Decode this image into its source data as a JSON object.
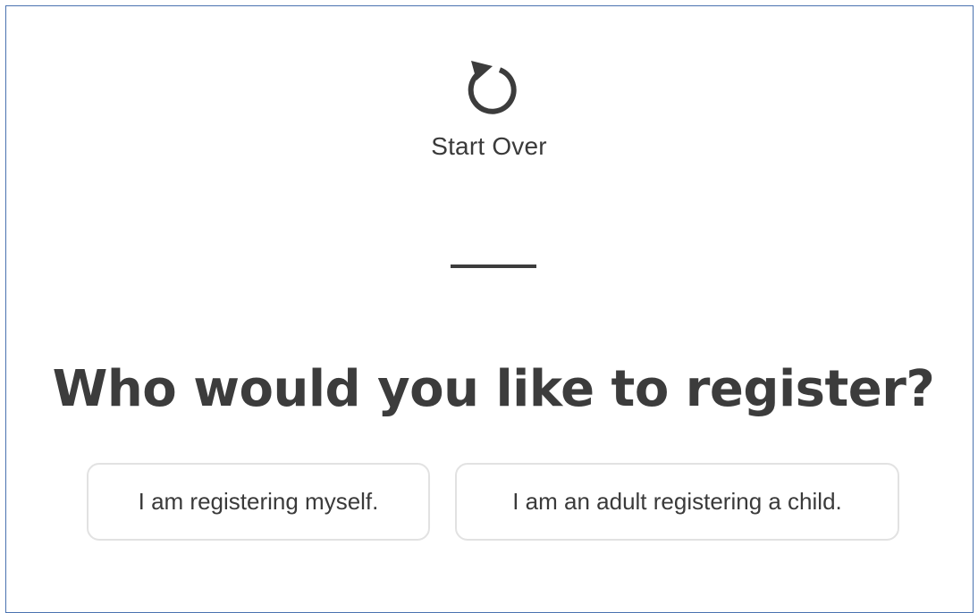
{
  "start_over": {
    "label": "Start Over",
    "icon": "refresh-icon"
  },
  "headline": "Who would you like to register?",
  "choices": {
    "self_label": "I am registering myself.",
    "child_label": "I am an adult registering a child."
  },
  "colors": {
    "text": "#3c3c3c",
    "border": "#e2e2e2",
    "frame": "#4a72b0"
  }
}
